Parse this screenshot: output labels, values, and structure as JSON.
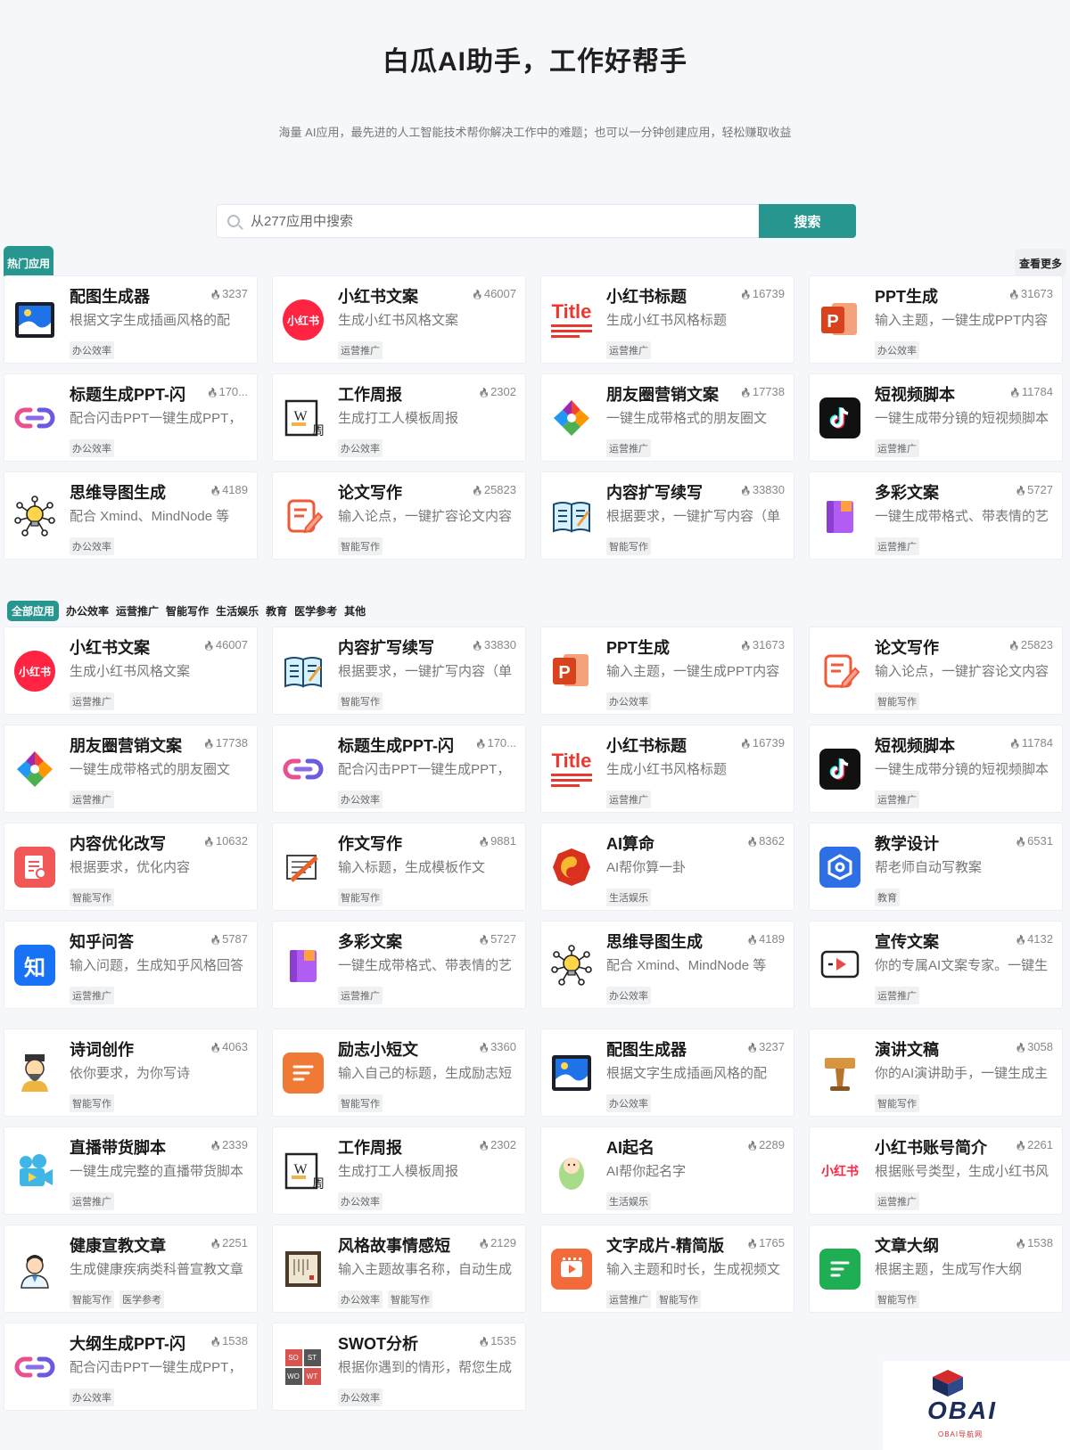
{
  "hero": {
    "title": "白瓜AI助手，工作好帮手",
    "subtitle": "海量 AI应用，最先进的人工智能技术帮你解决工作中的难题；也可以一分钟创建应用，轻松赚取收益"
  },
  "search": {
    "placeholder": "从277应用中搜索",
    "button": "搜索"
  },
  "hot": {
    "label": "热门应用",
    "more": "查看更多"
  },
  "hot_apps": [
    {
      "title": "配图生成器",
      "count": "3237",
      "desc": "根据文字生成插画风格的配",
      "tags": [
        "办公效率"
      ],
      "icon": "image-icon"
    },
    {
      "title": "小红书文案",
      "count": "46007",
      "desc": "生成小红书风格文案",
      "tags": [
        "运营推广"
      ],
      "icon": "xiaohongshu-icon"
    },
    {
      "title": "小红书标题",
      "count": "16739",
      "desc": "生成小红书风格标题",
      "tags": [
        "运营推广"
      ],
      "icon": "title-icon"
    },
    {
      "title": "PPT生成",
      "count": "31673",
      "desc": "输入主题，一键生成PPT内容",
      "tags": [
        "办公效率"
      ],
      "icon": "ppt-icon"
    },
    {
      "title": "标题生成PPT-闪",
      "count": "170...",
      "desc": "配合闪击PPT一键生成PPT，",
      "tags": [
        "办公效率"
      ],
      "icon": "link-icon"
    },
    {
      "title": "工作周报",
      "count": "2302",
      "desc": "生成打工人模板周报",
      "tags": [
        "办公效率"
      ],
      "icon": "weekly-icon"
    },
    {
      "title": "朋友圈营销文案",
      "count": "17738",
      "desc": "一键生成带格式的朋友圈文",
      "tags": [
        "运营推广"
      ],
      "icon": "aperture-icon"
    },
    {
      "title": "短视频脚本",
      "count": "11784",
      "desc": "一键生成带分镜的短视频脚本",
      "tags": [
        "运营推广"
      ],
      "icon": "tiktok-icon"
    },
    {
      "title": "思维导图生成",
      "count": "4189",
      "desc": "配合 Xmind、MindNode 等",
      "tags": [
        "办公效率"
      ],
      "icon": "bulb-icon"
    },
    {
      "title": "论文写作",
      "count": "25823",
      "desc": "输入论点，一键扩容论文内容",
      "tags": [
        "智能写作"
      ],
      "icon": "edit-icon"
    },
    {
      "title": "内容扩写续写",
      "count": "33830",
      "desc": "根据要求，一键扩写内容（单",
      "tags": [
        "智能写作"
      ],
      "icon": "book-icon"
    },
    {
      "title": "多彩文案",
      "count": "5727",
      "desc": "一键生成带格式、带表情的艺",
      "tags": [
        "运营推广"
      ],
      "icon": "notebook-icon"
    }
  ],
  "categories": [
    "全部应用",
    "办公效率",
    "运营推广",
    "智能写作",
    "生活娱乐",
    "教育",
    "医学参考",
    "其他"
  ],
  "all_apps": [
    {
      "title": "小红书文案",
      "count": "46007",
      "desc": "生成小红书风格文案",
      "tags": [
        "运营推广"
      ],
      "icon": "xiaohongshu-icon"
    },
    {
      "title": "内容扩写续写",
      "count": "33830",
      "desc": "根据要求，一键扩写内容（单",
      "tags": [
        "智能写作"
      ],
      "icon": "book-icon"
    },
    {
      "title": "PPT生成",
      "count": "31673",
      "desc": "输入主题，一键生成PPT内容",
      "tags": [
        "办公效率"
      ],
      "icon": "ppt-icon"
    },
    {
      "title": "论文写作",
      "count": "25823",
      "desc": "输入论点，一键扩容论文内容",
      "tags": [
        "智能写作"
      ],
      "icon": "edit-icon"
    },
    {
      "title": "朋友圈营销文案",
      "count": "17738",
      "desc": "一键生成带格式的朋友圈文",
      "tags": [
        "运营推广"
      ],
      "icon": "aperture-icon"
    },
    {
      "title": "标题生成PPT-闪",
      "count": "170...",
      "desc": "配合闪击PPT一键生成PPT，",
      "tags": [
        "办公效率"
      ],
      "icon": "link-icon"
    },
    {
      "title": "小红书标题",
      "count": "16739",
      "desc": "生成小红书风格标题",
      "tags": [
        "运营推广"
      ],
      "icon": "title-icon"
    },
    {
      "title": "短视频脚本",
      "count": "11784",
      "desc": "一键生成带分镜的短视频脚本",
      "tags": [
        "运营推广"
      ],
      "icon": "tiktok-icon"
    },
    {
      "title": "内容优化改写",
      "count": "10632",
      "desc": "根据要求，优化内容",
      "tags": [
        "智能写作"
      ],
      "icon": "doc-icon"
    },
    {
      "title": "作文写作",
      "count": "9881",
      "desc": "输入标题，生成模板作文",
      "tags": [
        "智能写作"
      ],
      "icon": "pencil-icon"
    },
    {
      "title": "AI算命",
      "count": "8362",
      "desc": "AI帮你算一卦",
      "tags": [
        "生活娱乐"
      ],
      "icon": "bagua-icon"
    },
    {
      "title": "教学设计",
      "count": "6531",
      "desc": "帮老师自动写教案",
      "tags": [
        "教育"
      ],
      "icon": "hexagon-icon"
    },
    {
      "title": "知乎问答",
      "count": "5787",
      "desc": "输入问题，生成知乎风格回答",
      "tags": [
        "运营推广"
      ],
      "icon": "zhihu-icon"
    },
    {
      "title": "多彩文案",
      "count": "5727",
      "desc": "一键生成带格式、带表情的艺",
      "tags": [
        "运营推广"
      ],
      "icon": "notebook-icon"
    },
    {
      "title": "思维导图生成",
      "count": "4189",
      "desc": "配合 Xmind、MindNode 等",
      "tags": [
        "办公效率"
      ],
      "icon": "bulb-icon"
    },
    {
      "title": "宣传文案",
      "count": "4132",
      "desc": "你的专属AI文案专家。一键生",
      "tags": [
        "运营推广"
      ],
      "icon": "video-icon"
    },
    {
      "title": "诗词创作",
      "count": "4063",
      "desc": "依你要求，为你写诗",
      "tags": [
        "智能写作"
      ],
      "icon": "poet-icon"
    },
    {
      "title": "励志小短文",
      "count": "3360",
      "desc": "输入自己的标题，生成励志短",
      "tags": [
        "智能写作"
      ],
      "icon": "list-icon"
    },
    {
      "title": "配图生成器",
      "count": "3237",
      "desc": "根据文字生成插画风格的配",
      "tags": [
        "办公效率"
      ],
      "icon": "image-icon"
    },
    {
      "title": "演讲文稿",
      "count": "3058",
      "desc": "你的AI演讲助手，一键生成主",
      "tags": [
        "智能写作"
      ],
      "icon": "podium-icon"
    },
    {
      "title": "直播带货脚本",
      "count": "2339",
      "desc": "一键生成完整的直播带货脚本",
      "tags": [
        "运营推广"
      ],
      "icon": "camera-icon"
    },
    {
      "title": "工作周报",
      "count": "2302",
      "desc": "生成打工人模板周报",
      "tags": [
        "办公效率"
      ],
      "icon": "weekly-icon"
    },
    {
      "title": "AI起名",
      "count": "2289",
      "desc": "AI帮你起名字",
      "tags": [
        "生活娱乐"
      ],
      "icon": "baby-icon"
    },
    {
      "title": "小红书账号简介",
      "count": "2261",
      "desc": "根据账号类型，生成小红书风",
      "tags": [
        "运营推广"
      ],
      "icon": "xiaohongshu-text-icon"
    },
    {
      "title": "健康宣教文章",
      "count": "2251",
      "desc": "生成健康疾病类科普宣教文章",
      "tags": [
        "智能写作",
        "医学参考"
      ],
      "icon": "doctor-icon"
    },
    {
      "title": "风格故事情感短",
      "count": "2129",
      "desc": "输入主题故事名称，自动生成",
      "tags": [
        "办公效率",
        "智能写作"
      ],
      "icon": "scroll-icon"
    },
    {
      "title": "文字成片-精简版",
      "count": "1765",
      "desc": "输入主题和时长，生成视频文",
      "tags": [
        "运营推广",
        "智能写作"
      ],
      "icon": "film-icon"
    },
    {
      "title": "文章大纲",
      "count": "1538",
      "desc": "根据主题，生成写作大纲",
      "tags": [
        "智能写作"
      ],
      "icon": "sheet-icon"
    },
    {
      "title": "大纲生成PPT-闪",
      "count": "1538",
      "desc": "配合闪击PPT一键生成PPT，",
      "tags": [
        "办公效率"
      ],
      "icon": "link-icon"
    },
    {
      "title": "SWOT分析",
      "count": "1535",
      "desc": "根据你遇到的情形，帮您生成",
      "tags": [
        "办公效率"
      ],
      "icon": "swot-icon"
    }
  ],
  "icon_text": {
    "xiaohongshu": "小红书",
    "title": "Title",
    "ppt": "P",
    "weekly_w": "W",
    "weekly_zhou": "周",
    "zhihu": "知",
    "swot": [
      "SO",
      "ST",
      "WO",
      "WT"
    ]
  },
  "watermark": {
    "brand": "OBAI",
    "sub": "OBAI导航网"
  },
  "colors": {
    "accent": "#27968f",
    "background": "#f5f7fa"
  }
}
